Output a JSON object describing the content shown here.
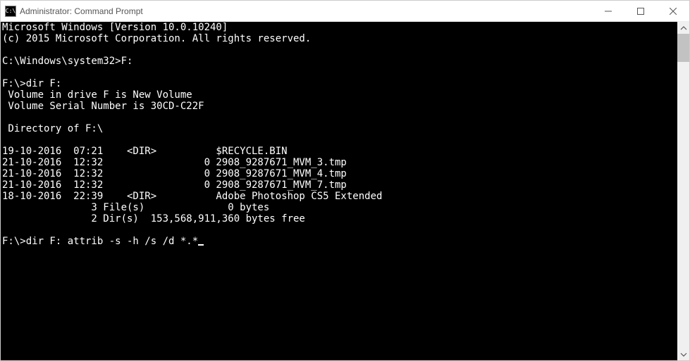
{
  "titlebar": {
    "icon_label": "C:\\",
    "title": "Administrator: Command Prompt"
  },
  "console": {
    "lines": [
      "Microsoft Windows [Version 10.0.10240]",
      "(c) 2015 Microsoft Corporation. All rights reserved.",
      "",
      "C:\\Windows\\system32>F:",
      "",
      "F:\\>dir F:",
      " Volume in drive F is New Volume",
      " Volume Serial Number is 30CD-C22F",
      "",
      " Directory of F:\\",
      "",
      "19-10-2016  07:21    <DIR>          $RECYCLE.BIN",
      "21-10-2016  12:32                 0 2908_9287671_MVM_3.tmp",
      "21-10-2016  12:32                 0 2908_9287671_MVM_4.tmp",
      "21-10-2016  12:32                 0 2908_9287671_MVM_7.tmp",
      "18-10-2016  22:39    <DIR>          Adobe Photoshop CS5 Extended",
      "               3 File(s)              0 bytes",
      "               2 Dir(s)  153,568,911,360 bytes free",
      "",
      "F:\\>dir F: attrib -s -h /s /d *.*"
    ]
  }
}
